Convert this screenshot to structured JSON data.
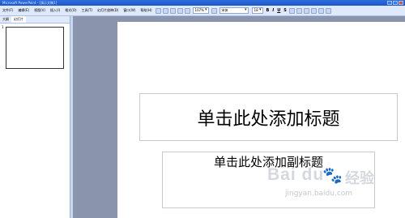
{
  "window": {
    "title": "Microsoft PowerPoint - [演示文稿1]"
  },
  "menubar": {
    "items": [
      "文件(F)",
      "编辑(E)",
      "视图(V)",
      "插入(I)",
      "格式(O)",
      "工具(T)",
      "幻灯片放映(D)",
      "窗口(W)",
      "帮助(H)"
    ],
    "zoom": "107%",
    "font": "宋体",
    "font_size": "18",
    "bold": "B",
    "italic": "I",
    "underline": "U",
    "shadow": "S"
  },
  "left_pane": {
    "tabs": [
      "大纲",
      "幻灯片"
    ],
    "slide_number": "1"
  },
  "slide": {
    "title_placeholder": "单击此处添加标题",
    "subtitle_placeholder": "单击此处添加副标题"
  },
  "watermark": {
    "brand": "Bai du",
    "paw": "🐾",
    "cn": "经验",
    "url": "jingyan.baidu.com"
  }
}
